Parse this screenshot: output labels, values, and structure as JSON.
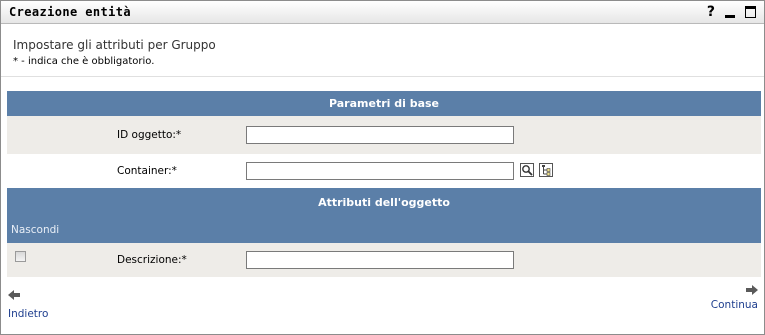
{
  "window": {
    "title": "Creazione entità",
    "help_glyph": "?"
  },
  "header": {
    "subtitle": "Impostare gli attributi per Gruppo",
    "required_note": "* - indica che è obbligatorio."
  },
  "basic_section": {
    "title": "Parametri di base",
    "fields": [
      {
        "label": "ID oggetto:*",
        "value": "",
        "placeholder": ""
      },
      {
        "label": "Container:*",
        "value": "",
        "placeholder": ""
      }
    ],
    "container_icons": [
      "search-icon",
      "browse-tree-icon"
    ]
  },
  "attributes_section": {
    "title": "Attributi dell'oggetto",
    "hide_label": "Nascondi",
    "rows": [
      {
        "label": "Descrizione:*",
        "value": "",
        "hidden_checked": false
      }
    ]
  },
  "navigation": {
    "back_label": "Indietro",
    "continue_label": "Continua"
  },
  "colors": {
    "section_header": "#5b7fa8",
    "row_shaded": "#eeece8",
    "link": "#1f3f8f"
  }
}
